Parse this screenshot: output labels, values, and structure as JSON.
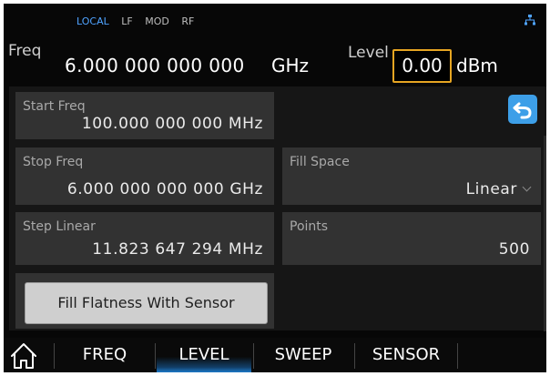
{
  "status": {
    "items": [
      "LOCAL",
      "LF",
      "MOD",
      "RF"
    ],
    "active": "LOCAL"
  },
  "header": {
    "freq_label": "Freq",
    "freq_value": "6.000 000 000 000",
    "freq_unit": "GHz",
    "level_label": "Level",
    "level_value": "0.00",
    "level_unit": "dBm"
  },
  "fields": {
    "start": {
      "label": "Start Freq",
      "value": "100.000 000 000 MHz"
    },
    "stop": {
      "label": "Stop Freq",
      "value": "6.000 000 000 000 GHz"
    },
    "step": {
      "label": "Step Linear",
      "value": "11.823 647 294 MHz"
    },
    "fill": {
      "label": "Fill Space",
      "value": "Linear"
    },
    "points": {
      "label": "Points",
      "value": "500"
    }
  },
  "buttons": {
    "fill_flatness": "Fill Flatness With Sensor"
  },
  "tabs": [
    "FREQ",
    "LEVEL",
    "SWEEP",
    "SENSOR"
  ],
  "selected_tab": "LEVEL",
  "colors": {
    "accent": "#3d9fe8",
    "highlight": "#e6a522",
    "active_status": "#4fa3ff"
  },
  "icons": {
    "back": "back-arrow-icon",
    "home": "home-icon",
    "network": "network-icon"
  }
}
